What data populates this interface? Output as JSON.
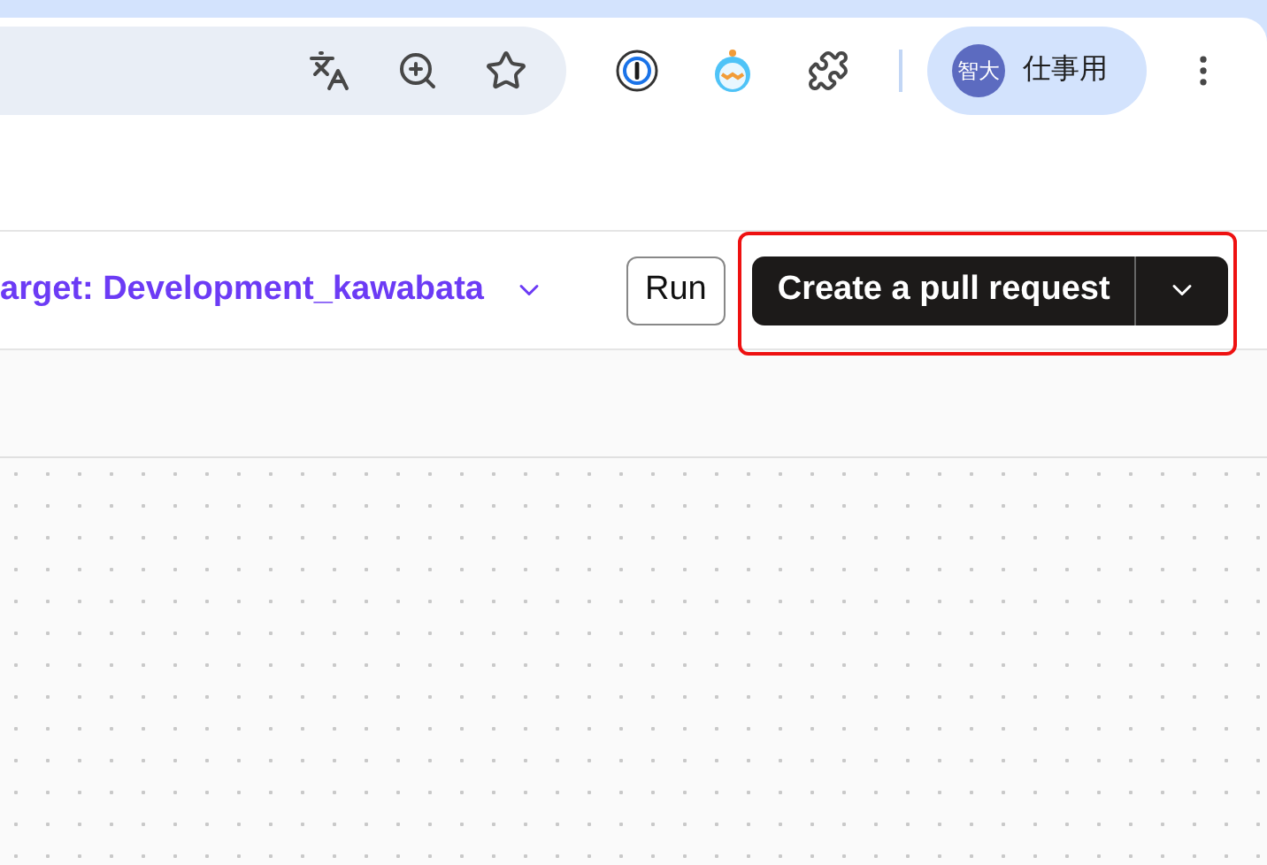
{
  "browser_toolbar": {
    "profile": {
      "avatar": "智大",
      "label": "仕事用"
    }
  },
  "page_toolbar": {
    "target": "arget: Development_kawabata",
    "run_button": "Run",
    "primary_button": "Create a pull request",
    "highlighted": true
  }
}
